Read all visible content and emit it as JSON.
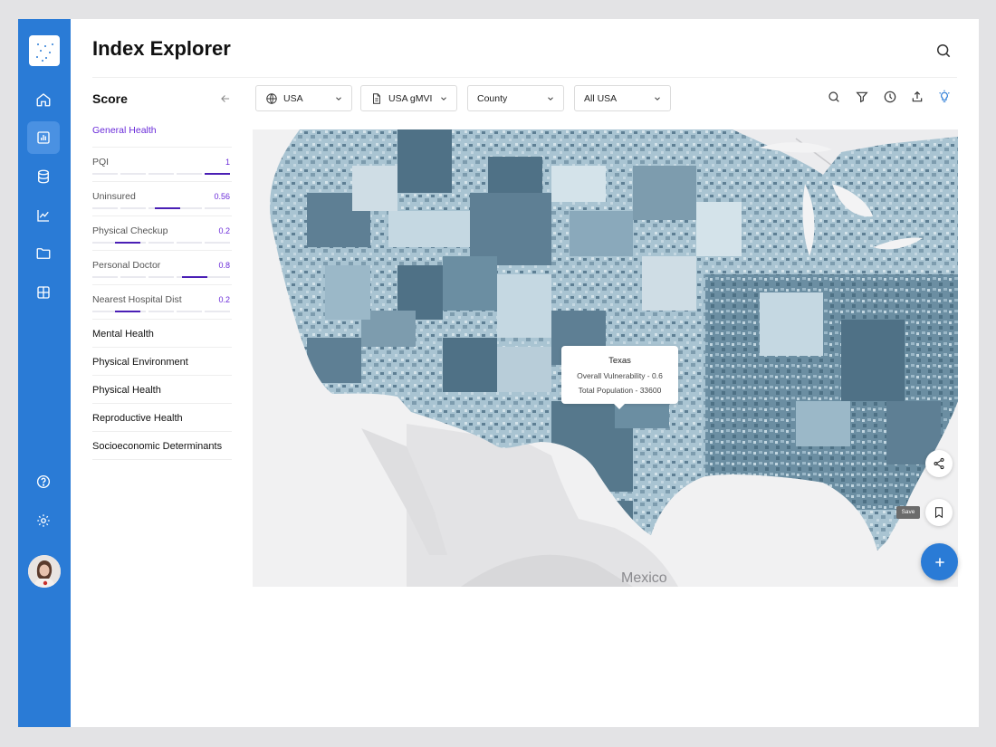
{
  "app": {
    "title": "Index Explorer"
  },
  "nav": {
    "items": [
      {
        "icon": "home-icon"
      },
      {
        "icon": "chart-bar-icon",
        "active": true
      },
      {
        "icon": "database-icon"
      },
      {
        "icon": "line-chart-icon"
      },
      {
        "icon": "folder-icon"
      },
      {
        "icon": "grid-icon"
      }
    ],
    "bottom": [
      {
        "icon": "help-icon"
      },
      {
        "icon": "settings-icon"
      }
    ],
    "accent_color": "#2a7bd6"
  },
  "panel": {
    "title": "Score",
    "active_group": "General Health",
    "metrics": [
      {
        "label": "PQI",
        "value": "1",
        "level": 1.0
      },
      {
        "label": "Uninsured",
        "value": "0.56",
        "level": 0.56
      },
      {
        "label": "Physical Checkup",
        "value": "0.2",
        "level": 0.2
      },
      {
        "label": "Personal Doctor",
        "value": "0.8",
        "level": 0.8
      },
      {
        "label": "Nearest Hospital Dist",
        "value": "0.2",
        "level": 0.2
      }
    ],
    "groups": [
      "Mental Health",
      "Physical Environment",
      "Physical Health",
      "Reproductive Health",
      "Socioeconomic Determinants"
    ]
  },
  "filters": {
    "country": "USA",
    "index": "USA gMVI",
    "level": "County",
    "region": "All USA"
  },
  "tools": [
    "search-icon",
    "filter-icon",
    "history-icon",
    "export-icon",
    "insight-icon"
  ],
  "map": {
    "country_label": "Mexico",
    "tooltip": {
      "title": "Texas",
      "line1": "Overall Vulnerability - 0.6",
      "line2": "Total Population - 33600"
    }
  },
  "actions": {
    "save_label": "Save"
  }
}
